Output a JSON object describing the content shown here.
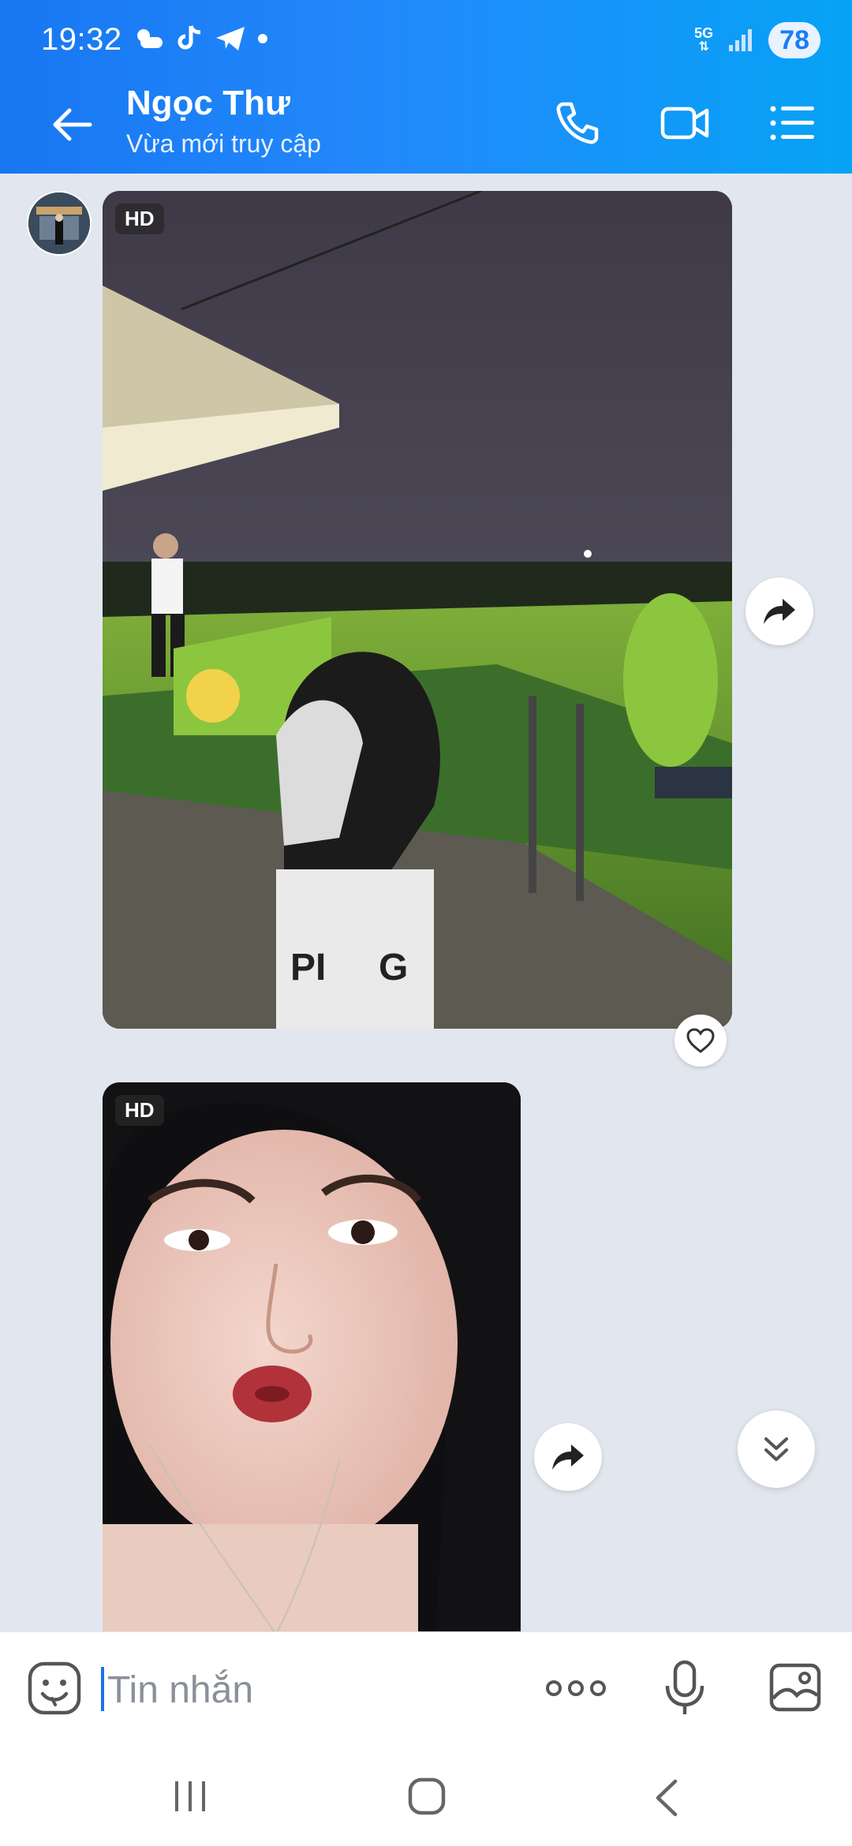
{
  "status_bar": {
    "time": "19:32",
    "network": "5G",
    "battery": "78",
    "icons": [
      "weather-cloudy-icon",
      "tiktok-icon",
      "telegram-icon",
      "dot-icon",
      "signal-icon"
    ]
  },
  "header": {
    "contact_name": "Ngọc Thư",
    "contact_status": "Vừa mới truy cập",
    "icons": [
      "back-arrow-icon",
      "phone-icon",
      "video-call-icon",
      "menu-icon"
    ]
  },
  "messages": [
    {
      "type": "image",
      "badge": "HD",
      "description_icon": "golf-range-photo"
    },
    {
      "type": "image",
      "badge": "HD",
      "description_icon": "selfie-photo"
    }
  ],
  "input": {
    "placeholder": "Tin nhắn",
    "icons": [
      "emoji-icon",
      "more-icon",
      "microphone-icon",
      "image-icon"
    ]
  },
  "colors": {
    "header_start": "#1877f2",
    "header_end": "#06a3f6",
    "chat_background": "#e2e7ef",
    "accent": "#1a73e8"
  }
}
